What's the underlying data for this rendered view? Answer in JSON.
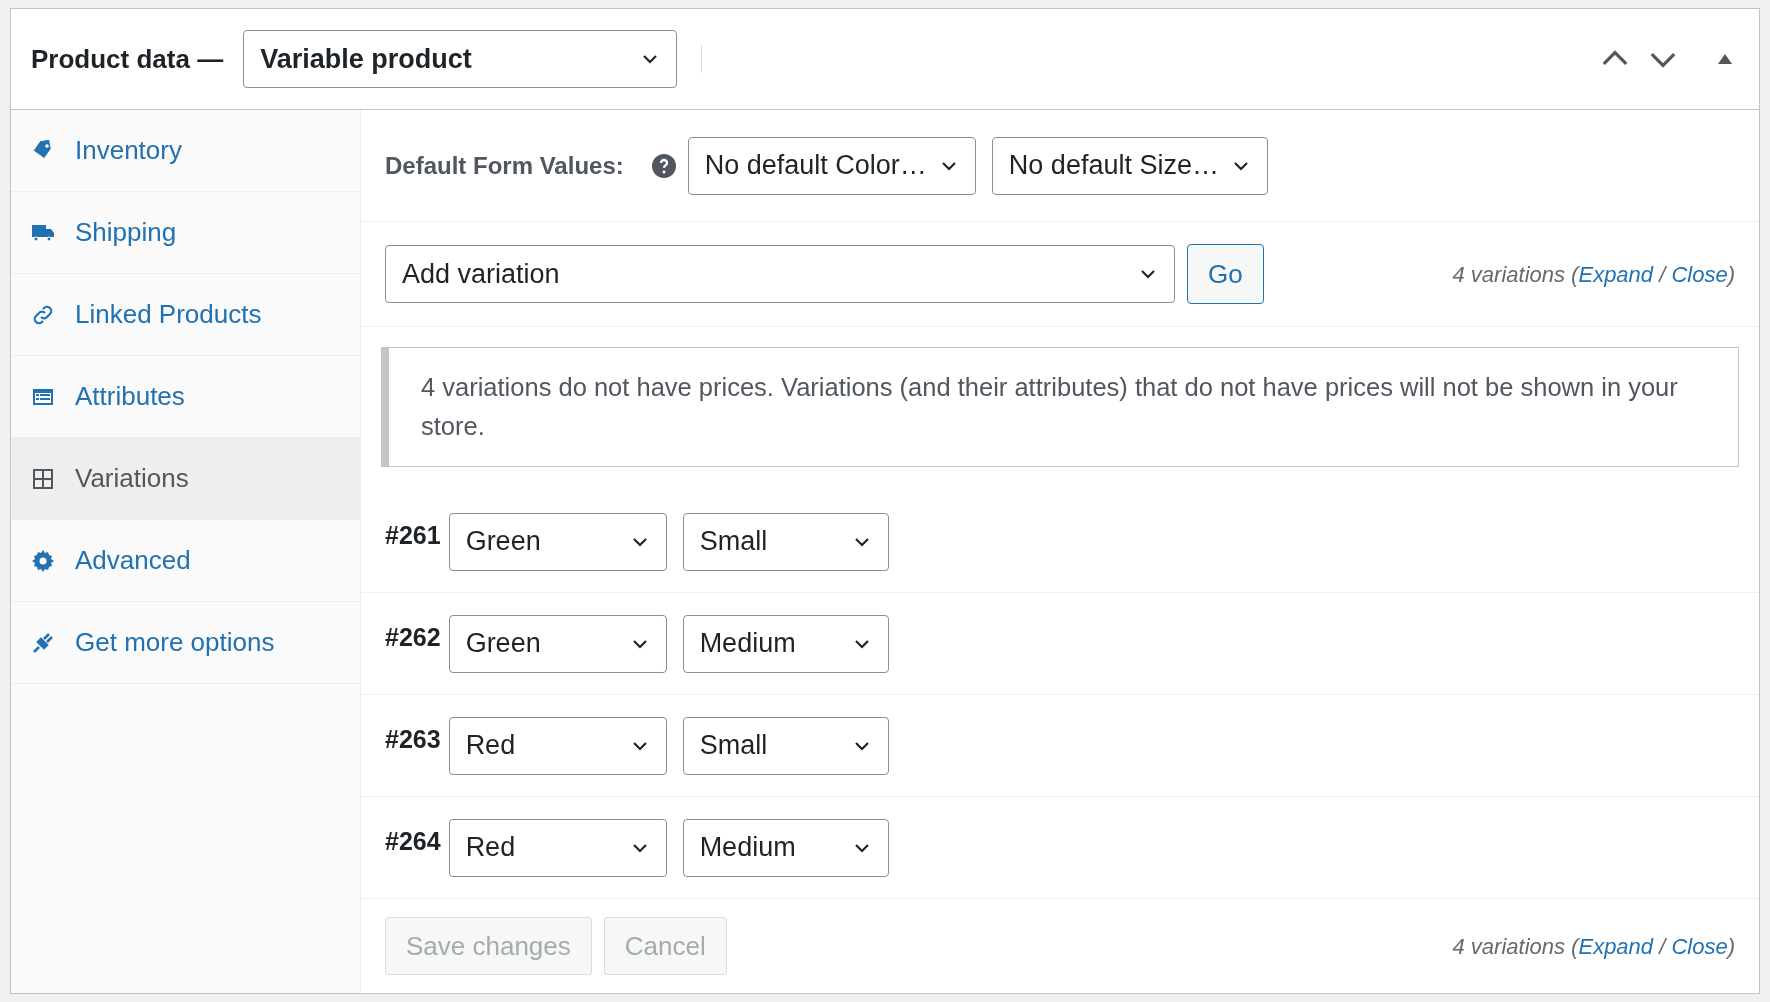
{
  "header": {
    "title": "Product data —",
    "product_type": "Variable product"
  },
  "sidebar": {
    "items": [
      {
        "label": "Inventory",
        "kind": "tag",
        "selected": false
      },
      {
        "label": "Shipping",
        "kind": "truck",
        "selected": false
      },
      {
        "label": "Linked Products",
        "kind": "link",
        "selected": false
      },
      {
        "label": "Attributes",
        "kind": "list",
        "selected": false
      },
      {
        "label": "Variations",
        "kind": "grid",
        "selected": true
      },
      {
        "label": "Advanced",
        "kind": "gear",
        "selected": false
      },
      {
        "label": "Get more options",
        "kind": "plug",
        "selected": false
      }
    ]
  },
  "defaults": {
    "label": "Default Form Values:",
    "selects": [
      "No default Color…",
      "No default Size…"
    ]
  },
  "actions": {
    "select": "Add variation",
    "button": "Go"
  },
  "summary_top": [
    {
      "kind": "text",
      "text": "4 variations ("
    },
    {
      "kind": "link",
      "text": "Expand"
    },
    {
      "kind": "text",
      "text": " / "
    },
    {
      "kind": "link",
      "text": "Close"
    },
    {
      "kind": "text",
      "text": ")"
    }
  ],
  "notice": "4 variations do not have prices. Variations (and their attributes) that do not have prices will not be shown in your store.",
  "variations": [
    {
      "id": "#261",
      "attributes": [
        "Green",
        "Small"
      ]
    },
    {
      "id": "#262",
      "attributes": [
        "Green",
        "Medium"
      ]
    },
    {
      "id": "#263",
      "attributes": [
        "Red",
        "Small"
      ]
    },
    {
      "id": "#264",
      "attributes": [
        "Red",
        "Medium"
      ]
    }
  ],
  "footer": {
    "buttons": [
      {
        "label": "Save changes",
        "disabled": true
      },
      {
        "label": "Cancel",
        "disabled": true
      }
    ],
    "summary": [
      {
        "kind": "text",
        "text": "4 variations ("
      },
      {
        "kind": "link",
        "text": "Expand"
      },
      {
        "kind": "text",
        "text": " / "
      },
      {
        "kind": "link",
        "text": "Close"
      },
      {
        "kind": "text",
        "text": ")"
      }
    ]
  }
}
